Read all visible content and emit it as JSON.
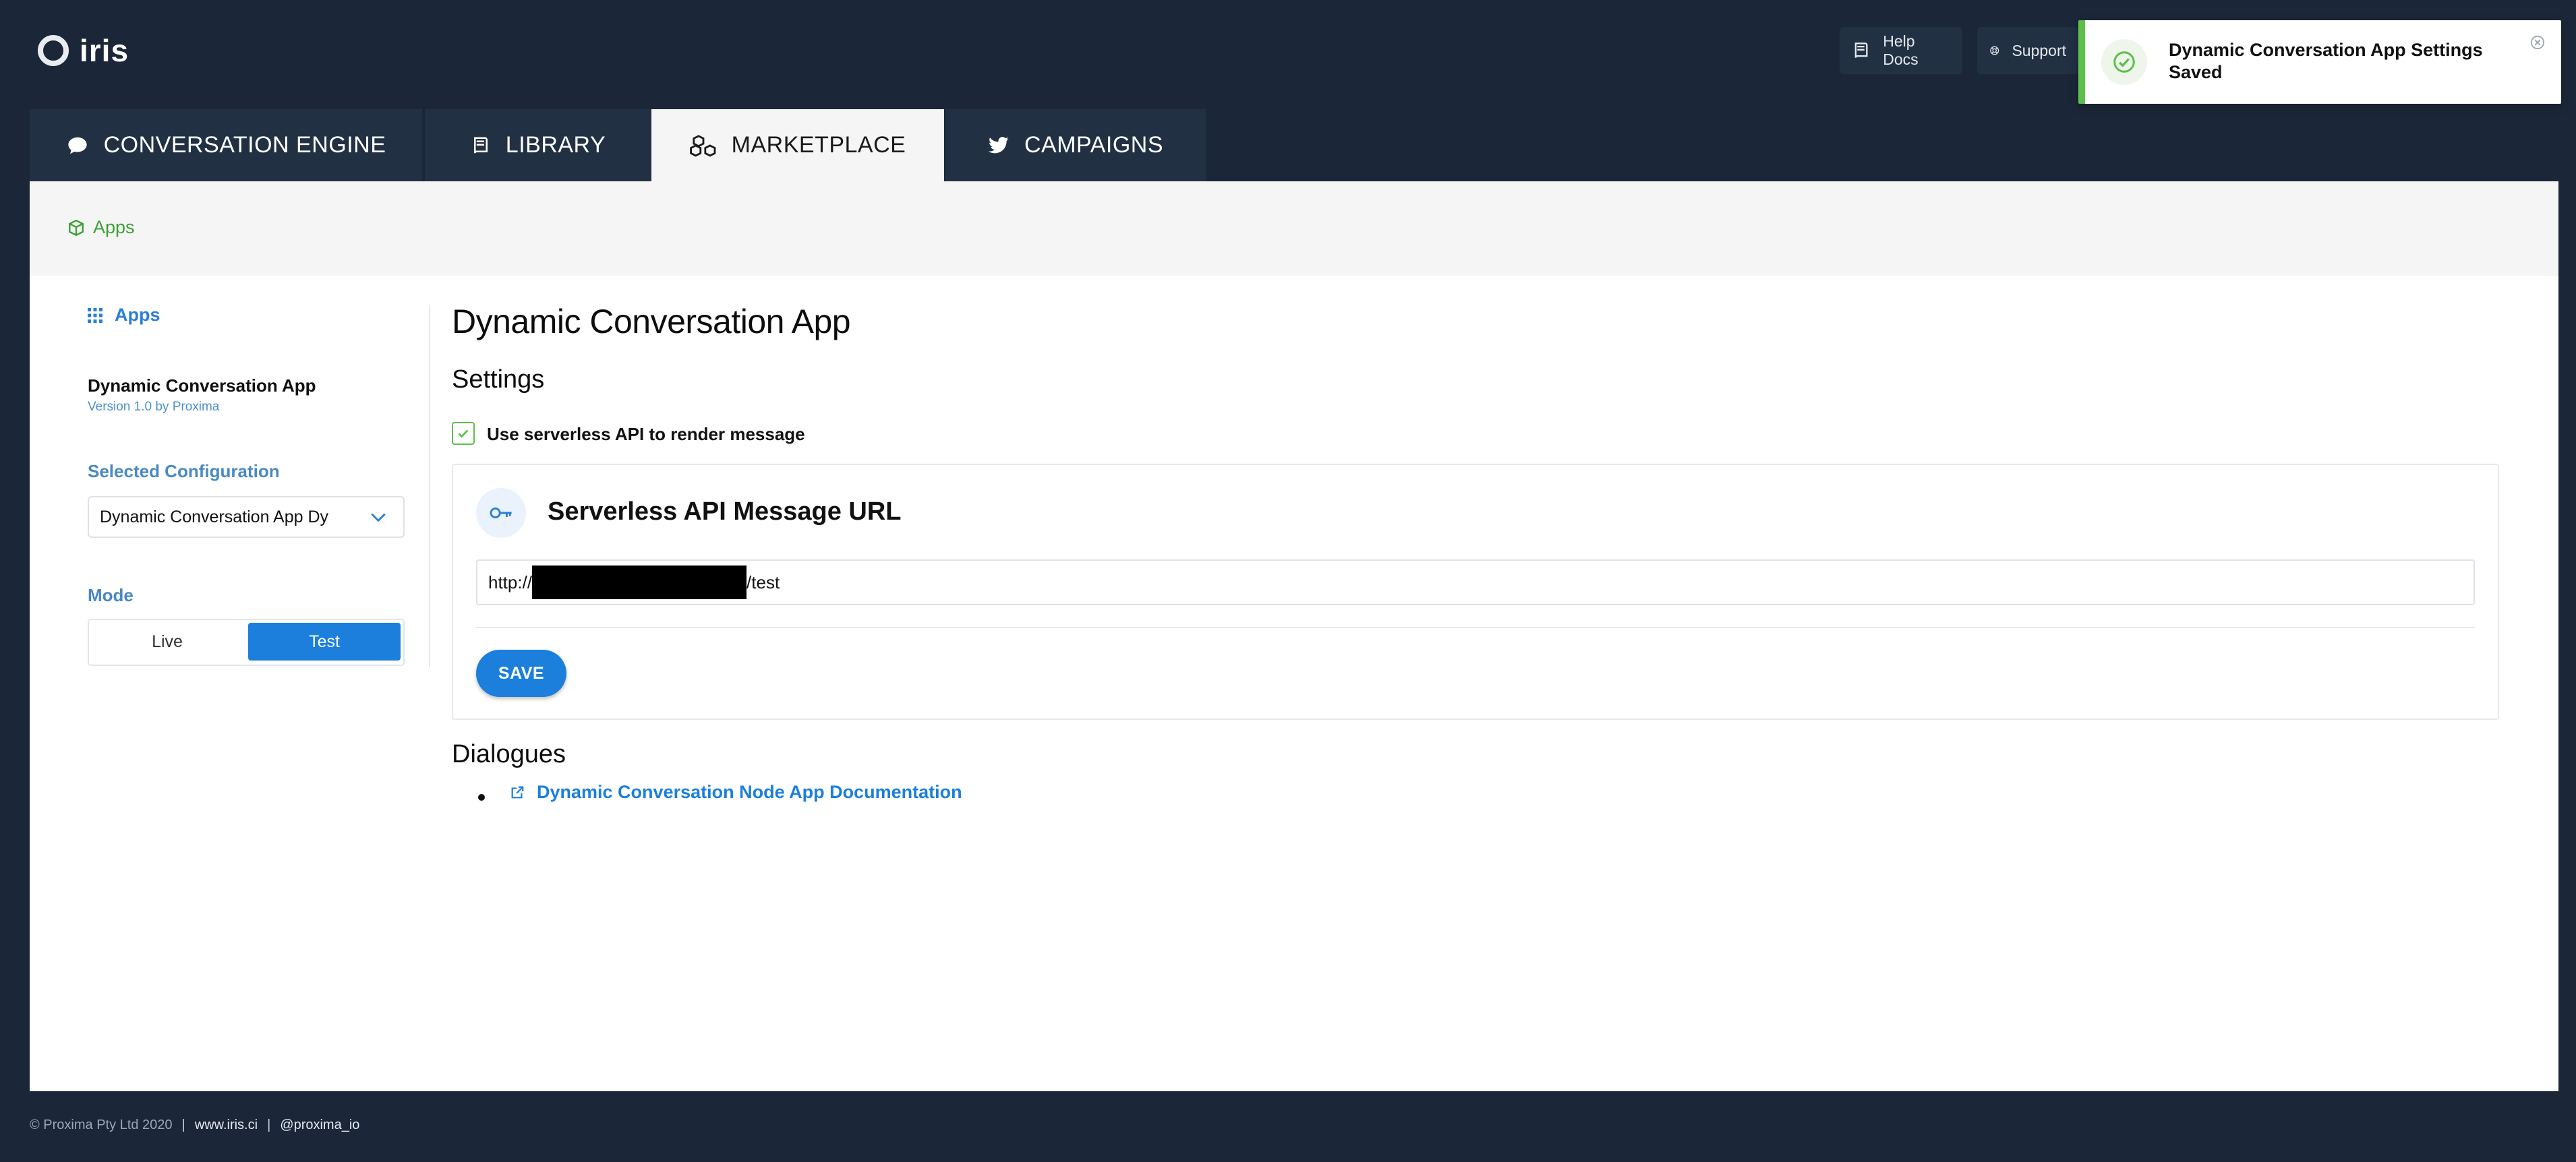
{
  "brand": {
    "name": "iris"
  },
  "header": {
    "help_docs": "Help Docs",
    "support": "Support"
  },
  "toast": {
    "message": "Dynamic Conversation App Settings Saved",
    "status_color": "#5cbf4a"
  },
  "tabs": [
    {
      "label": "CONVERSATION ENGINE",
      "icon": "comment-icon",
      "active": false
    },
    {
      "label": "LIBRARY",
      "icon": "book-icon",
      "active": false
    },
    {
      "label": "MARKETPLACE",
      "icon": "cubes-icon",
      "active": true
    },
    {
      "label": "CAMPAIGNS",
      "icon": "twitter-icon",
      "active": false
    }
  ],
  "breadcrumb": {
    "label": "Apps",
    "icon": "cube-icon"
  },
  "sidebar": {
    "apps_link": "Apps",
    "app_title": "Dynamic Conversation App",
    "app_version": "Version 1.0 by Proxima",
    "config_label": "Selected Configuration",
    "config_value": "Dynamic Conversation App Dy",
    "mode_label": "Mode",
    "mode_options": [
      "Live",
      "Test"
    ],
    "mode_selected": "Test"
  },
  "main": {
    "title": "Dynamic Conversation App",
    "settings_heading": "Settings",
    "serverless_checkbox": {
      "label": "Use serverless API to render message",
      "checked": true
    },
    "card": {
      "title": "Serverless API Message URL",
      "url_prefix": "http://",
      "url_suffix": "/test",
      "save_label": "SAVE"
    },
    "dialogues_heading": "Dialogues",
    "dialogues_links": [
      "Dynamic Conversation Node App Documentation"
    ]
  },
  "footer": {
    "copyright": "© Proxima Pty Ltd 2020",
    "separator": "|",
    "site": "www.iris.ci",
    "handle": "@proxima_io"
  },
  "colors": {
    "background": "#1b2738",
    "accent": "#1b7fdb",
    "success": "#5cbf4a",
    "crumb": "#3aa135"
  }
}
